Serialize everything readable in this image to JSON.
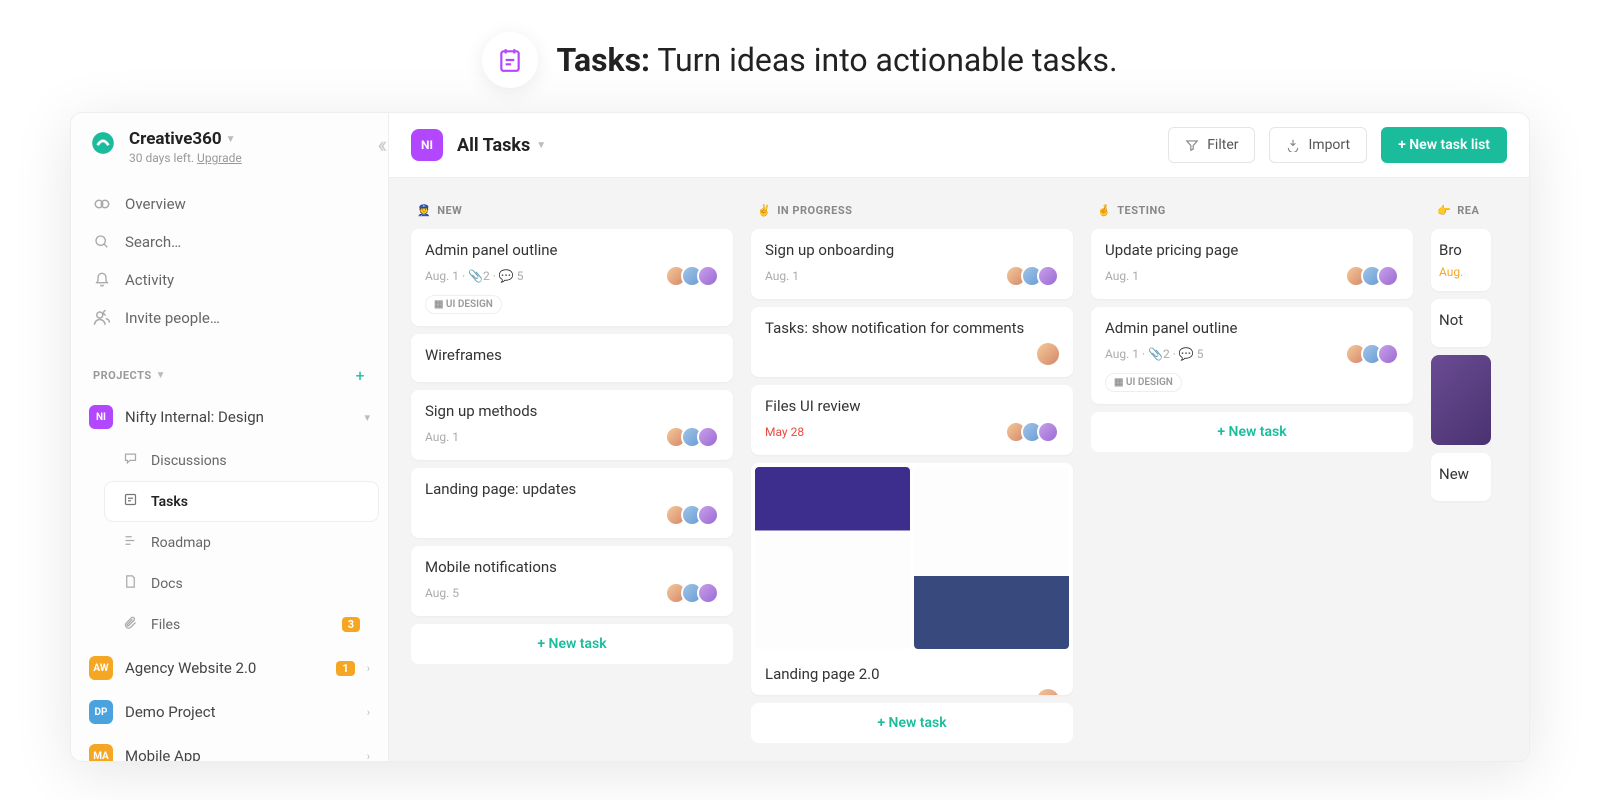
{
  "hero": {
    "bold": "Tasks:",
    "rest": " Turn ideas into actionable tasks."
  },
  "workspace": {
    "name": "Creative360",
    "trial": "30 days left. ",
    "upgrade": "Upgrade"
  },
  "nav": {
    "overview": "Overview",
    "search": "Search…",
    "activity": "Activity",
    "invite": "Invite people…"
  },
  "projects_label": "PROJECTS",
  "projects": [
    {
      "badge": "NI",
      "color": "#b347ff",
      "name": "Nifty Internal: Design",
      "expanded": true,
      "sub": [
        {
          "icon": "discussions",
          "label": "Discussions"
        },
        {
          "icon": "tasks",
          "label": "Tasks",
          "active": true
        },
        {
          "icon": "roadmap",
          "label": "Roadmap"
        },
        {
          "icon": "docs",
          "label": "Docs"
        },
        {
          "icon": "files",
          "label": "Files",
          "count": "3"
        }
      ]
    },
    {
      "badge": "AW",
      "color": "#f5a623",
      "name": "Agency Website 2.0",
      "count": "1"
    },
    {
      "badge": "DP",
      "color": "#4aa3df",
      "name": "Demo Project"
    },
    {
      "badge": "MA",
      "color": "#f5a623",
      "name": "Mobile App"
    }
  ],
  "topbar": {
    "badge": "NI",
    "title": "All Tasks",
    "filter": "Filter",
    "import": "Import",
    "new_list": "+ New task list"
  },
  "columns": [
    {
      "emoji": "👮",
      "title": "NEW",
      "cards": [
        {
          "title": "Admin panel outline",
          "meta": "Aug. 1 · 📎2 · 💬 5",
          "avatars": 3,
          "tag": "UI DESIGN"
        },
        {
          "title": "Wireframes"
        },
        {
          "title": "Sign up methods",
          "meta": "Aug. 1",
          "avatars": 3
        },
        {
          "title": "Landing page: updates",
          "avatars": 3
        },
        {
          "title": "Mobile notifications",
          "meta": "Aug. 5",
          "avatars": 3
        }
      ],
      "new_task": "+ New task"
    },
    {
      "emoji": "✌️",
      "title": "IN PROGRESS",
      "cards": [
        {
          "title": "Sign up onboarding",
          "meta": "Aug. 1",
          "avatars": 3
        },
        {
          "title": "Tasks: show notification for comments",
          "single_av": true
        },
        {
          "title": "Files UI review",
          "meta": "May 28",
          "meta_class": "due",
          "avatars": 3
        },
        {
          "image": true,
          "title": "Landing page 2.0",
          "single_av": true
        }
      ],
      "new_task": "+ New task"
    },
    {
      "emoji": "🤞",
      "title": "TESTING",
      "cards": [
        {
          "title": "Update pricing page",
          "meta": "Aug. 1",
          "avatars": 3
        },
        {
          "title": "Admin panel outline",
          "meta": "Aug. 1 · 📎2 · 💬 5",
          "avatars": 3,
          "tag": "UI DESIGN"
        }
      ],
      "new_task": "+ New task"
    },
    {
      "emoji": "👉",
      "title": "REA",
      "partial": true,
      "cards": [
        {
          "title": "Bro",
          "meta": "Aug.",
          "meta_class": "soon"
        },
        {
          "title": "Not"
        },
        {
          "purple": true
        },
        {
          "title": "New"
        }
      ]
    }
  ]
}
